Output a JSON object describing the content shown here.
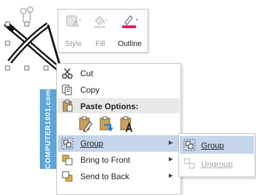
{
  "mini_toolbar": {
    "style_label": "Style",
    "fill_label": "Fill",
    "outline_label": "Outline",
    "outline_color": "#e8175d"
  },
  "watermark": {
    "text": "COMPUTER1001.com"
  },
  "context_menu": {
    "cut": {
      "label": "Cut",
      "icon": "scissors-icon"
    },
    "copy": {
      "label": "Copy",
      "icon": "copy-icon"
    },
    "paste_options": {
      "label": "Paste Options:",
      "icon": "clipboard-icon"
    },
    "group": {
      "label": "Group",
      "icon": "group-icon",
      "has_submenu": true
    },
    "bring_to_front": {
      "label": "Bring to Front",
      "icon": "bring-to-front-icon",
      "has_submenu": true
    },
    "send_to_back": {
      "label": "Send to Back",
      "icon": "send-to-back-icon",
      "has_submenu": true
    }
  },
  "submenu": {
    "group": {
      "label": "Group",
      "icon": "group-icon"
    },
    "ungroup": {
      "label": "Ungroup",
      "icon": "ungroup-icon",
      "disabled": true
    }
  },
  "colors": {
    "highlight": "#c5d5ea",
    "watermark_bg": "#5ea6d8"
  }
}
